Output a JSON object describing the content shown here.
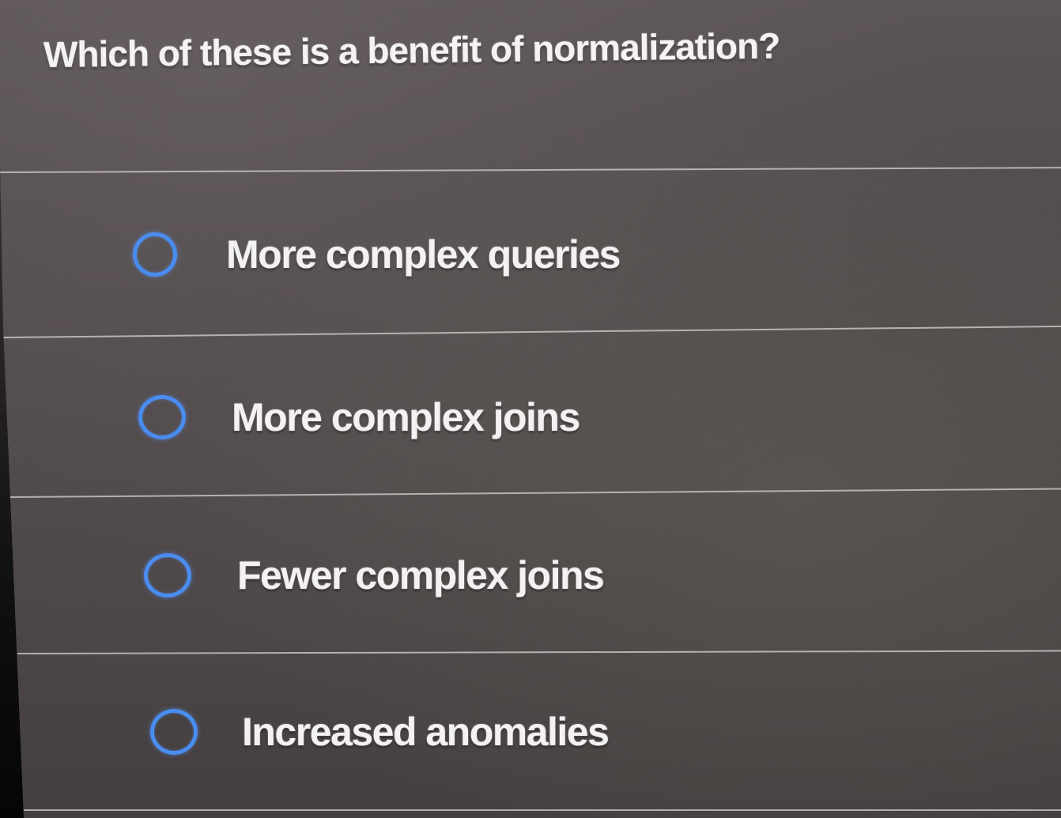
{
  "question": {
    "text": "Which of these is a benefit of normalization?"
  },
  "options": [
    {
      "label": "More complex queries",
      "selected": false
    },
    {
      "label": "More complex joins",
      "selected": false
    },
    {
      "label": "Fewer complex joins",
      "selected": false
    },
    {
      "label": "Increased anomalies",
      "selected": false
    }
  ],
  "colors": {
    "radio_accent": "#4a8df0",
    "text": "#f3f1f2",
    "background": "#524c4d"
  }
}
